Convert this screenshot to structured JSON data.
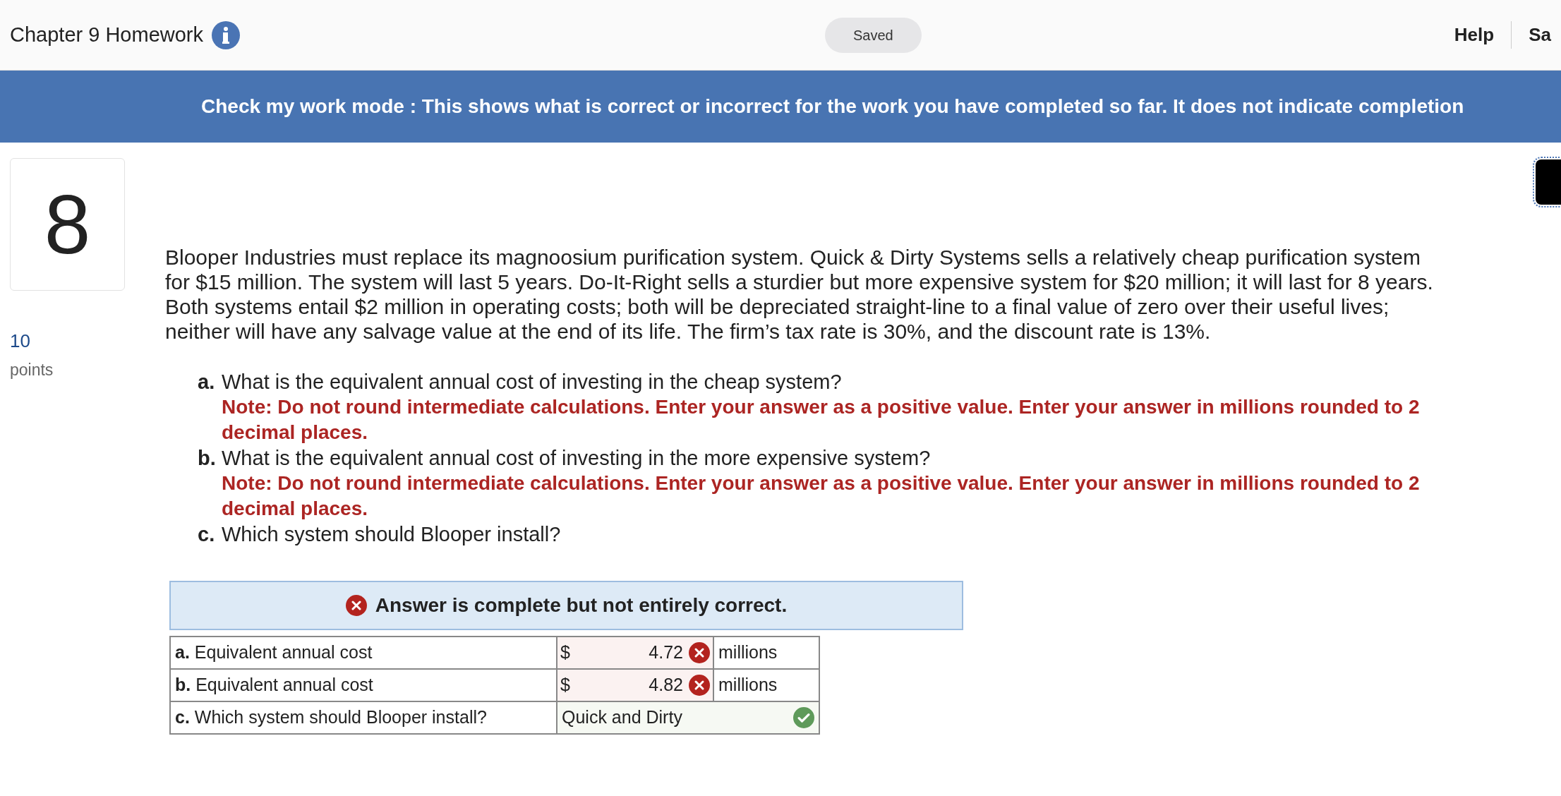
{
  "header": {
    "title": "Chapter 9 Homework",
    "status": "Saved",
    "help": "Help",
    "cut_link": "Sa"
  },
  "banner": {
    "text": "Check my work mode : This shows what is correct or incorrect for the work you have completed so far. It does not indicate completion"
  },
  "question": {
    "number": "8",
    "points": "10",
    "points_label": "points",
    "paragraph_lines": [
      "Blooper Industries must replace its magnoosium purification system. Quick & Dirty Systems sells a relatively cheap purification system",
      "for $15 million. The system will last 5 years. Do-It-Right sells a sturdier but more expensive system for $20 million; it will last for 8 years.",
      "Both systems entail $2 million in operating costs; both will be depreciated straight-line to a final value of zero over their useful lives;",
      "neither will have any salvage value at the end of its life. The firm’s tax rate is 30%, and the discount rate is 13%."
    ],
    "parts": [
      {
        "letter": "a.",
        "text": "What is the equivalent annual cost of investing in the cheap system?",
        "note": "Note: Do not round intermediate calculations. Enter your answer as a positive value. Enter your answer in millions rounded to 2 decimal places."
      },
      {
        "letter": "b.",
        "text": "What is the equivalent annual cost of investing in the more expensive system?",
        "note": "Note: Do not round intermediate calculations. Enter your answer as a positive value. Enter your answer in millions rounded to 2 decimal places."
      },
      {
        "letter": "c.",
        "text": "Which system should Blooper install?"
      }
    ]
  },
  "result": {
    "message": "Answer is complete but not entirely correct.",
    "correct": false
  },
  "answers": [
    {
      "kind": "amount",
      "letter": "a.",
      "label": "Equivalent annual cost",
      "currency": "$",
      "value": "4.72",
      "unit": "millions",
      "correct": false
    },
    {
      "kind": "amount",
      "letter": "b.",
      "label": "Equivalent annual cost",
      "currency": "$",
      "value": "4.82",
      "unit": "millions",
      "correct": false
    },
    {
      "kind": "choice",
      "letter": "c.",
      "label": "Which system should Blooper install?",
      "value": "Quick and Dirty",
      "correct": true
    }
  ]
}
